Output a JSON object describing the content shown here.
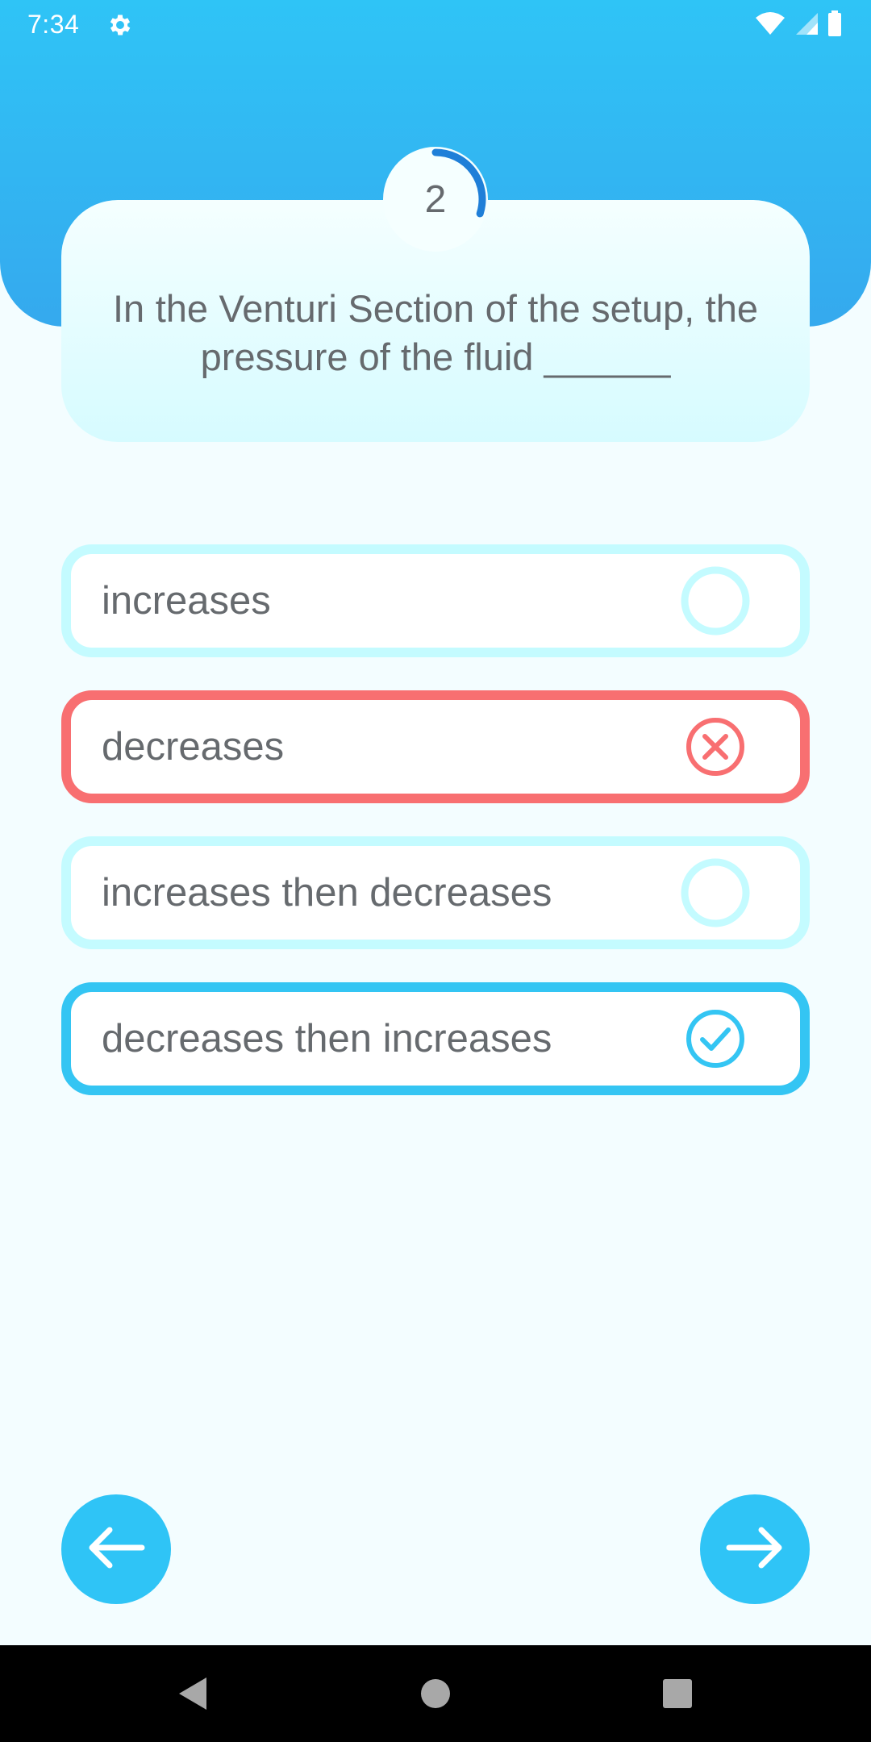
{
  "status_bar": {
    "time": "7:34",
    "icons": [
      "settings-icon",
      "wifi-icon",
      "signal-icon",
      "battery-icon"
    ]
  },
  "question": {
    "number": "2",
    "text": "In the Venturi Section of the setup, the pressure of the fluid ______",
    "progress": 0.3
  },
  "options": [
    {
      "label": "increases",
      "state": "unselected"
    },
    {
      "label": "decreases",
      "state": "wrong"
    },
    {
      "label": "increases then decreases",
      "state": "unselected"
    },
    {
      "label": "decreases then increases",
      "state": "correct"
    }
  ],
  "navigation": {
    "prev_icon": "arrow-left-icon",
    "next_icon": "arrow-right-icon"
  },
  "system_nav": [
    "back-icon",
    "home-icon",
    "recents-icon"
  ],
  "colors": {
    "header_top": "#2fc4f6",
    "header_bottom": "#35a9ee",
    "unselected_border": "#c4fbff",
    "wrong": "#f86f71",
    "correct": "#34c5f3",
    "progress_arc": "#1f7fd8",
    "text": "#666a6e"
  }
}
